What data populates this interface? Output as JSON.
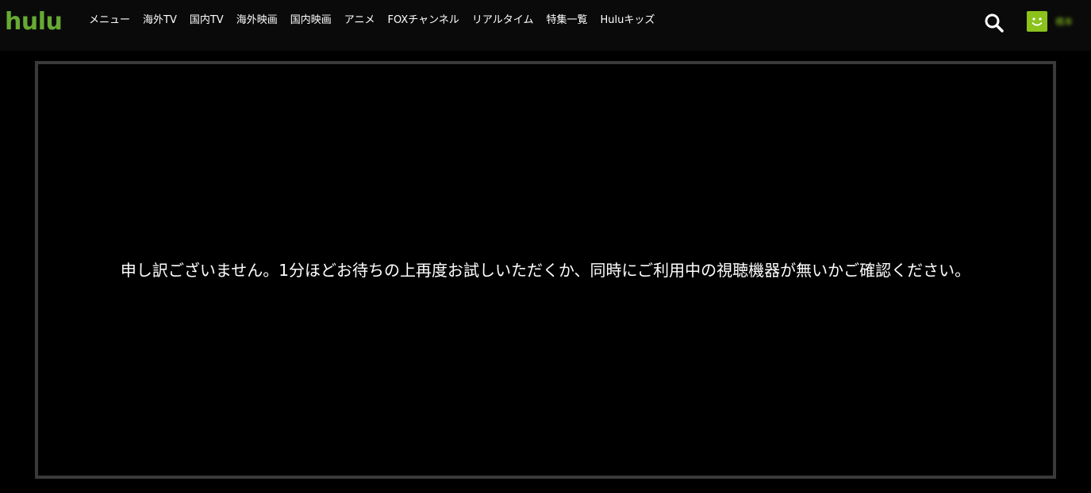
{
  "header": {
    "logo_text": "hulu",
    "nav": [
      {
        "label": "メニュー"
      },
      {
        "label": "海外TV"
      },
      {
        "label": "国内TV"
      },
      {
        "label": "海外映画"
      },
      {
        "label": "国内映画"
      },
      {
        "label": "アニメ"
      },
      {
        "label": "FOXチャンネル"
      },
      {
        "label": "リアルタイム"
      },
      {
        "label": "特集一覧"
      },
      {
        "label": "Huluキッズ"
      }
    ],
    "search_icon": "search-icon",
    "avatar_icon": "smiley-icon",
    "username": "橋本"
  },
  "player": {
    "error_message": "申し訳ございません。1分ほどお待ちの上再度お試しいただくか、同時にご利用中の視聴機器が無いかご確認ください。"
  },
  "colors": {
    "brand_green": "#66aa33",
    "avatar_green": "#8bc21c",
    "header_bg": "#0a0a0a",
    "player_border": "#3a3a3a"
  }
}
